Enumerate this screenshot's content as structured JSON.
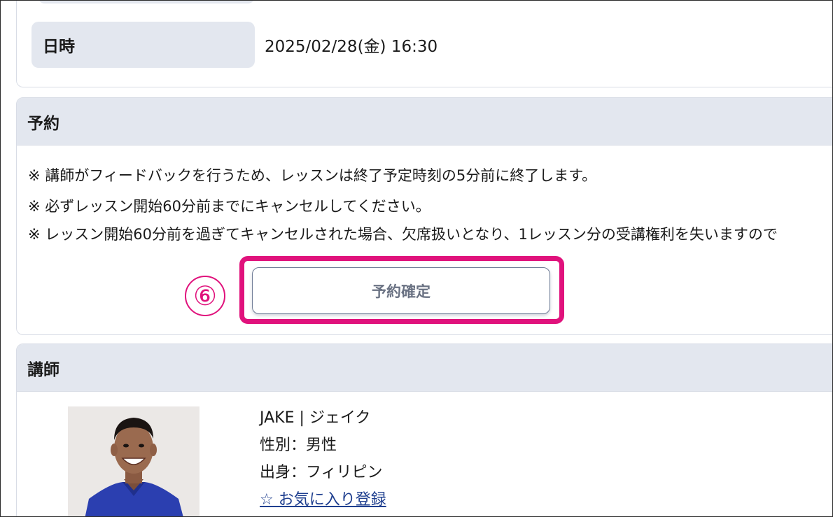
{
  "datetime": {
    "label": "日時",
    "value": "2025/02/28(金) 16:30"
  },
  "reservation": {
    "title": "予約",
    "notes": [
      "※ 講師がフィードバックを行うため、レッスンは終了予定時刻の5分前に終了します。",
      "※ 必ずレッスン開始60分前までにキャンセルしてください。",
      "※ レッスン開始60分前を過ぎてキャンセルされた場合、欠席扱いとなり、1レッスン分の受講権利を失いますので"
    ],
    "step_marker": "⑥",
    "confirm_label": "予約確定",
    "highlight_color": "#e0127c"
  },
  "teacher": {
    "title": "講師",
    "name": "JAKE | ジェイク",
    "gender": "性別：男性",
    "origin": "出身：フィリピン",
    "favorite_label": "☆ お気に入り登録"
  }
}
